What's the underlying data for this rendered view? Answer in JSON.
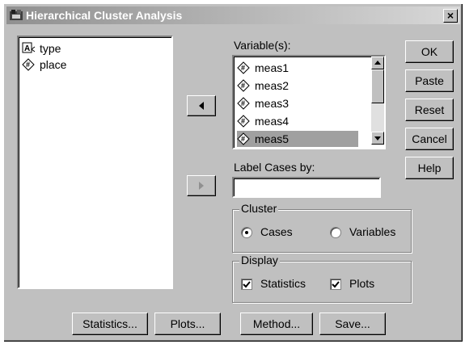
{
  "window": {
    "title": "Hierarchical Cluster Analysis",
    "close_glyph": "×"
  },
  "source_list": {
    "items": [
      {
        "label": "type",
        "icon": "string-variable-icon"
      },
      {
        "label": "place",
        "icon": "numeric-variable-icon"
      }
    ]
  },
  "variables": {
    "label": "Variable(s):",
    "items": [
      "meas1",
      "meas2",
      "meas3",
      "meas4",
      "meas5"
    ]
  },
  "label_cases": {
    "label": "Label Cases by:",
    "value": ""
  },
  "cluster_group": {
    "title": "Cluster",
    "options": [
      {
        "label": "Cases",
        "selected": true
      },
      {
        "label": "Variables",
        "selected": false
      }
    ]
  },
  "display_group": {
    "title": "Display",
    "options": [
      {
        "label": "Statistics",
        "checked": true
      },
      {
        "label": "Plots",
        "checked": true
      }
    ]
  },
  "right_buttons": [
    "OK",
    "Paste",
    "Reset",
    "Cancel",
    "Help"
  ],
  "bottom_buttons": [
    "Statistics...",
    "Plots...",
    "Method...",
    "Save..."
  ],
  "colors": {
    "titlebar_start": "#909090",
    "titlebar_end": "#d8d8d8",
    "face": "#c0c0c0"
  }
}
